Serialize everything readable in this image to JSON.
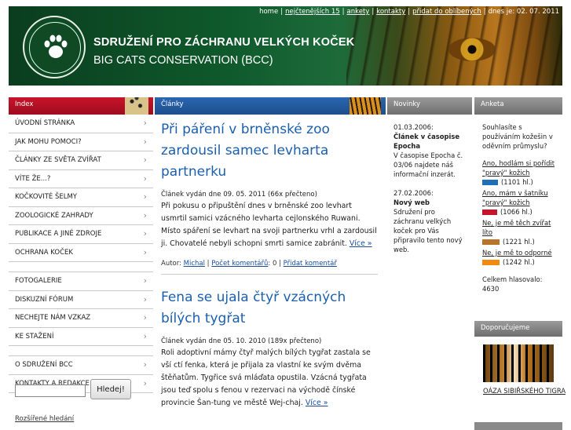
{
  "header": {
    "title_cz": "SDRUŽENÍ PRO ZÁCHRANU VELKÝCH KOČEK",
    "title_en": "BIG CATS CONSERVATION (BCC)",
    "logo_text": "SDRUŽENÍ PRO ZÁCHRANU VELKÝCH KOČEK · BIG CATS CONSERVATION",
    "topnav": {
      "home": "home",
      "newest": "nejčtenějších 15",
      "polls": "ankety",
      "contacts": "kontakty",
      "favorites": "přidat do oblíbených",
      "date": "dnes je: 02. 07. 2011"
    }
  },
  "columns": {
    "index": "Index",
    "articles": "Články",
    "news": "Novinky",
    "poll": "Anketa",
    "recommended": "Doporučujeme"
  },
  "sidebar": {
    "items": [
      "ÚVODNÍ STRÁNKA",
      "JAK MOHU POMOCI?",
      "ČLÁNKY ZE SVĚTA ZVÍŘAT",
      "VÍTE ŽE...?",
      "KOČKOVITÉ ŠELMY",
      "ZOOLOGICKÉ ZAHRADY",
      "PUBLIKACE A JINÉ ZDROJE",
      "OCHRANA KOČEK"
    ],
    "items2": [
      "FOTOGALERIE",
      "DISKUZNÍ FÓRUM",
      "NECHEJTE NÁM VZKAZ",
      "KE STAŽENÍ"
    ],
    "items3": [
      "O SDRUŽENÍ BCC",
      "KONTAKTY A REDAKCE"
    ],
    "search_button": "Hledej!",
    "search_value": "",
    "advanced_search": "Rozšířené hledání"
  },
  "articles": [
    {
      "title": "Při páření v brněnské zoo zardousil samec levharta partnerku",
      "meta": "Článek vydán dne 09. 05. 2011 (66x přečteno)",
      "body": "Při pokusu o připuštění dnes v brněnské zoo levhart usmrtil samici vzácného levharta cejlonského Ruwani. Místo spáření se levhart na svoji partnerku vrhl a zardousil ji. Chovatelé nebyli schopni smrti samice zabránit.",
      "more": "Více »",
      "author_label": "Autor:",
      "author": "Michal",
      "comments_label": "Počet komentářů",
      "comments": ": 0 |",
      "add_comment": "Přidat komentář"
    },
    {
      "title": "Fena se ujala čtyř vzácných bílých tygřat",
      "meta": "Článek vydán dne 05. 10. 2010 (189x přečteno)",
      "body": "Roli adoptivní mámy čtyř malých bílých tygřat zastala se vší ctí fenka, která je přijala za vlastní ke svým dvěma štěňatům. Tygřice svá mláďata opustila. Vzácná tygřata jsou teď spolu s fenou v rezervaci na východě čínské provincie Šan-tung ve městě Wej-chaj.",
      "more": "Více »"
    }
  ],
  "news": [
    {
      "date": "01.03.2006:",
      "headline": "Článek v časopise Epocha",
      "text": "V časopise Epocha č. 03/06 najdete náš informační inzerát."
    },
    {
      "date": "27.02.2006:",
      "headline": "Nový web",
      "text": "Sdružení pro záchranu velkých koček pro Vás připravilo tento nový web."
    }
  ],
  "poll": {
    "question": "Souhlasíte s používáním kožešin v oděvním průmyslu?",
    "options": [
      {
        "label": "Ano, hodlám si pořídit \"pravý\" kožich",
        "count": "(1101 hl.)",
        "votes": 1101,
        "color": "#1f6fb8"
      },
      {
        "label": "Ano, mám v šatníku \"pravý\" kožich",
        "count": "(1066 hl.)",
        "votes": 1066,
        "color": "#c8142a"
      },
      {
        "label": "Ne, je mě těch zvířat líto",
        "count": "(1221 hl.)",
        "votes": 1221,
        "color": "#b8742a"
      },
      {
        "label": "Ne, je mě to odporné",
        "count": "(1242 hl.)",
        "votes": 1242,
        "color": "#f08a10"
      }
    ],
    "total_label": "Celkem hlasovalo:",
    "total": "4630"
  },
  "recommended": {
    "link": "OÁZA SIBIŘSKÉHO TIGRA"
  }
}
